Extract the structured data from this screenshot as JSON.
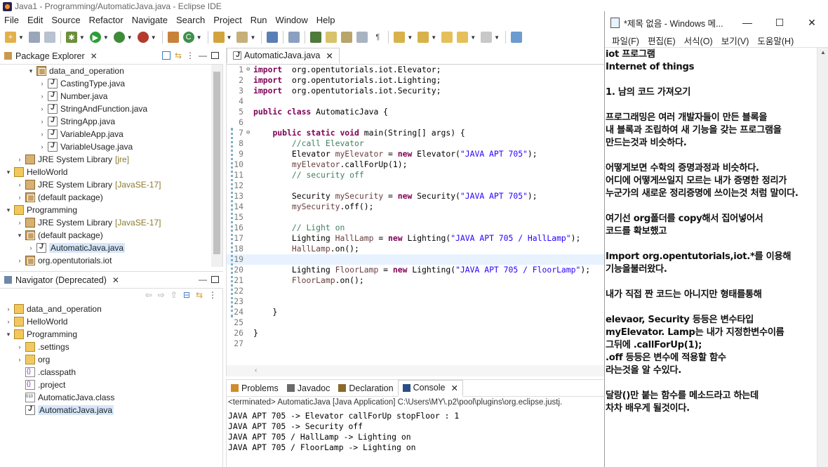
{
  "window": {
    "title": "Java1 - Programming/AutomaticJava.java - Eclipse IDE"
  },
  "menubar": [
    "File",
    "Edit",
    "Source",
    "Refactor",
    "Navigate",
    "Search",
    "Project",
    "Run",
    "Window",
    "Help"
  ],
  "package_explorer": {
    "title": "Package Explorer",
    "rows": [
      {
        "indent": 2,
        "twisty": "▾",
        "icon": "ic-pkg",
        "label": "data_and_operation",
        "suffix": ""
      },
      {
        "indent": 3,
        "twisty": "›",
        "icon": "ic-java",
        "label": "CastingType.java",
        "suffix": ""
      },
      {
        "indent": 3,
        "twisty": "›",
        "icon": "ic-java",
        "label": "Number.java",
        "suffix": ""
      },
      {
        "indent": 3,
        "twisty": "›",
        "icon": "ic-java",
        "label": "StringAndFunction.java",
        "suffix": ""
      },
      {
        "indent": 3,
        "twisty": "›",
        "icon": "ic-java",
        "label": "StringApp.java",
        "suffix": ""
      },
      {
        "indent": 3,
        "twisty": "›",
        "icon": "ic-java",
        "label": "VariableApp.java",
        "suffix": ""
      },
      {
        "indent": 3,
        "twisty": "›",
        "icon": "ic-java",
        "label": "VariableUsage.java",
        "suffix": ""
      },
      {
        "indent": 1,
        "twisty": "›",
        "icon": "ic-lib",
        "label": "JRE System Library",
        "suffix": "[jre]"
      },
      {
        "indent": 0,
        "twisty": "▾",
        "icon": "ic-proj",
        "label": "HelloWorld",
        "suffix": ""
      },
      {
        "indent": 1,
        "twisty": "›",
        "icon": "ic-lib",
        "label": "JRE System Library",
        "suffix": "[JavaSE-17]"
      },
      {
        "indent": 1,
        "twisty": "›",
        "icon": "ic-pkg",
        "label": "(default package)",
        "suffix": ""
      },
      {
        "indent": 0,
        "twisty": "▾",
        "icon": "ic-proj",
        "label": "Programming",
        "suffix": ""
      },
      {
        "indent": 1,
        "twisty": "›",
        "icon": "ic-lib",
        "label": "JRE System Library",
        "suffix": "[JavaSE-17]"
      },
      {
        "indent": 1,
        "twisty": "▾",
        "icon": "ic-pkg",
        "label": "(default package)",
        "suffix": ""
      },
      {
        "indent": 2,
        "twisty": "›",
        "icon": "ic-java",
        "label": "AutomaticJava.java",
        "suffix": "",
        "selected": true
      },
      {
        "indent": 1,
        "twisty": "›",
        "icon": "ic-pkg",
        "label": "org.opentutorials.iot",
        "suffix": ""
      }
    ]
  },
  "navigator": {
    "title": "Navigator (Deprecated)",
    "rows": [
      {
        "indent": 0,
        "twisty": "›",
        "icon": "ic-proj",
        "label": "data_and_operation"
      },
      {
        "indent": 0,
        "twisty": "›",
        "icon": "ic-proj",
        "label": "HelloWorld"
      },
      {
        "indent": 0,
        "twisty": "▾",
        "icon": "ic-proj",
        "label": "Programming"
      },
      {
        "indent": 1,
        "twisty": "›",
        "icon": "ic-folder",
        "label": ".settings"
      },
      {
        "indent": 1,
        "twisty": "›",
        "icon": "ic-folder",
        "label": "org"
      },
      {
        "indent": 1,
        "twisty": "",
        "icon": "ic-xml",
        "label": ".classpath"
      },
      {
        "indent": 1,
        "twisty": "",
        "icon": "ic-xml",
        "label": ".project"
      },
      {
        "indent": 1,
        "twisty": "",
        "icon": "ic-class",
        "label": "AutomaticJava.class"
      },
      {
        "indent": 1,
        "twisty": "",
        "icon": "ic-java",
        "label": "AutomaticJava.java",
        "selected": true
      }
    ]
  },
  "editor": {
    "tab_label": "AutomaticJava.java",
    "current_line": 19,
    "lines": [
      {
        "n": "1",
        "fold": "⊖",
        "segs": [
          [
            "kw",
            "import"
          ],
          [
            "",
            "  org.opentutorials.iot.Elevator;"
          ]
        ]
      },
      {
        "n": "2",
        "segs": [
          [
            "kw",
            "import"
          ],
          [
            "",
            "  org.opentutorials.iot.Lighting;"
          ]
        ]
      },
      {
        "n": "3",
        "segs": [
          [
            "kw",
            "import"
          ],
          [
            "",
            "  org.opentutorials.iot.Security;"
          ]
        ]
      },
      {
        "n": "4",
        "segs": []
      },
      {
        "n": "5",
        "segs": [
          [
            "kw",
            "public class"
          ],
          [
            "",
            " AutomaticJava {"
          ]
        ]
      },
      {
        "n": "6",
        "segs": []
      },
      {
        "n": "7",
        "fold": "⊖",
        "segs": [
          [
            "",
            "    "
          ],
          [
            "kw",
            "public static void"
          ],
          [
            "",
            " main(String[] args) {"
          ]
        ]
      },
      {
        "n": "8",
        "segs": [
          [
            "",
            "        "
          ],
          [
            "cm",
            "//call Elevator"
          ]
        ]
      },
      {
        "n": "9",
        "segs": [
          [
            "",
            "        Elevator "
          ],
          [
            "fd",
            "myElevator"
          ],
          [
            "",
            " = "
          ],
          [
            "kw",
            "new"
          ],
          [
            "",
            " Elevator("
          ],
          [
            "st",
            "\"JAVA APT 705\""
          ],
          [
            "",
            ");"
          ]
        ]
      },
      {
        "n": "10",
        "segs": [
          [
            "",
            "        "
          ],
          [
            "fd",
            "myElevator"
          ],
          [
            "",
            ".callForUp(1);"
          ]
        ]
      },
      {
        "n": "11",
        "segs": [
          [
            "",
            "        "
          ],
          [
            "cm",
            "// security off"
          ]
        ]
      },
      {
        "n": "12",
        "segs": []
      },
      {
        "n": "13",
        "segs": [
          [
            "",
            "        Security "
          ],
          [
            "fd",
            "mySecurity"
          ],
          [
            "",
            " = "
          ],
          [
            "kw",
            "new"
          ],
          [
            "",
            " Security("
          ],
          [
            "st",
            "\"JAVA APT 705\""
          ],
          [
            "",
            ");"
          ]
        ]
      },
      {
        "n": "14",
        "segs": [
          [
            "",
            "        "
          ],
          [
            "fd",
            "mySecurity"
          ],
          [
            "",
            ".off();"
          ]
        ]
      },
      {
        "n": "15",
        "segs": []
      },
      {
        "n": "16",
        "segs": [
          [
            "",
            "        "
          ],
          [
            "cm",
            "// Light on"
          ]
        ]
      },
      {
        "n": "17",
        "segs": [
          [
            "",
            "        Lighting "
          ],
          [
            "fd",
            "HallLamp"
          ],
          [
            "",
            " = "
          ],
          [
            "kw",
            "new"
          ],
          [
            "",
            " Lighting("
          ],
          [
            "st",
            "\"JAVA APT 705 / HallLamp\""
          ],
          [
            "",
            ");"
          ]
        ]
      },
      {
        "n": "18",
        "segs": [
          [
            "",
            "        "
          ],
          [
            "fd",
            "HallLamp"
          ],
          [
            "",
            ".on();"
          ]
        ]
      },
      {
        "n": "19",
        "segs": []
      },
      {
        "n": "20",
        "segs": [
          [
            "",
            "        Lighting "
          ],
          [
            "fd",
            "FloorLamp"
          ],
          [
            "",
            " = "
          ],
          [
            "kw",
            "new"
          ],
          [
            "",
            " Lighting("
          ],
          [
            "st",
            "\"JAVA APT 705 / FloorLamp\""
          ],
          [
            "",
            ");"
          ]
        ]
      },
      {
        "n": "21",
        "segs": [
          [
            "",
            "        "
          ],
          [
            "fd",
            "FloorLamp"
          ],
          [
            "",
            ".on();"
          ]
        ]
      },
      {
        "n": "22",
        "segs": []
      },
      {
        "n": "23",
        "segs": []
      },
      {
        "n": "24",
        "segs": [
          [
            "",
            "    }"
          ]
        ]
      },
      {
        "n": "25",
        "segs": []
      },
      {
        "n": "26",
        "segs": [
          [
            "",
            "}"
          ]
        ]
      },
      {
        "n": "27",
        "segs": []
      }
    ]
  },
  "console": {
    "tabs": [
      "Problems",
      "Javadoc",
      "Declaration",
      "Console"
    ],
    "active_tab": "Console",
    "status": "<terminated> AutomaticJava [Java Application] C:\\Users\\MY\\.p2\\pool\\plugins\\org.eclipse.justj.",
    "output": [
      "JAVA APT 705 -> Elevator callForUp stopFloor : 1",
      "JAVA APT 705 -> Security off",
      "JAVA APT 705 / HallLamp -> Lighting on",
      "JAVA APT 705 / FloorLamp -> Lighting on"
    ]
  },
  "notepad": {
    "title": "*제목 없음 - Windows 메...",
    "menus": [
      "파일(F)",
      "편집(E)",
      "서식(O)",
      "보기(V)",
      "도움말(H)"
    ],
    "lines": [
      "iot 프로그램",
      "Internet of things",
      "",
      "1. 남의 코드 가져오기",
      "",
      "프로그래밍은 여러 개발자들이 만든 블록을",
      "내 블록과 조립하여 새 기능을 갖는 프로그램을",
      "만드는것과 비슷하다.",
      "",
      "어떻게보면 수학의 증명과정과 비슷하다.",
      "어디에 어떻게쓰일지 모르는 내가 증명한 정리가",
      "누군가의 새로운 정리증명에 쓰이는것 처럼 말이다.",
      "",
      "여기선 org폴더를 copy해서 집어넣어서",
      "코드를 확보했고",
      "",
      "Import  org.opentutorials,iot.*를 이용해",
      "기능을불러왔다.",
      "",
      "내가 직접 짠 코드는 아니지만 형태를통해",
      "",
      "elevaor, Security 등등은 변수타입",
      "myElevator. Lamp는 내가 지정한변수이름",
      "그뒤에 .callForUp(1);",
      ".off 등등은 변수에 적용할 함수",
      "라는것을 알 수있다.",
      "",
      "달랑()만 붙는 함수를 메소드라고 하는데",
      "차차 배우게 될것이다."
    ]
  },
  "colors": {
    "keyword": "#7f0055",
    "comment": "#3f7f5f",
    "string": "#2a00ff",
    "field": "#6a3e3e",
    "selection": "#d6e7fb"
  }
}
